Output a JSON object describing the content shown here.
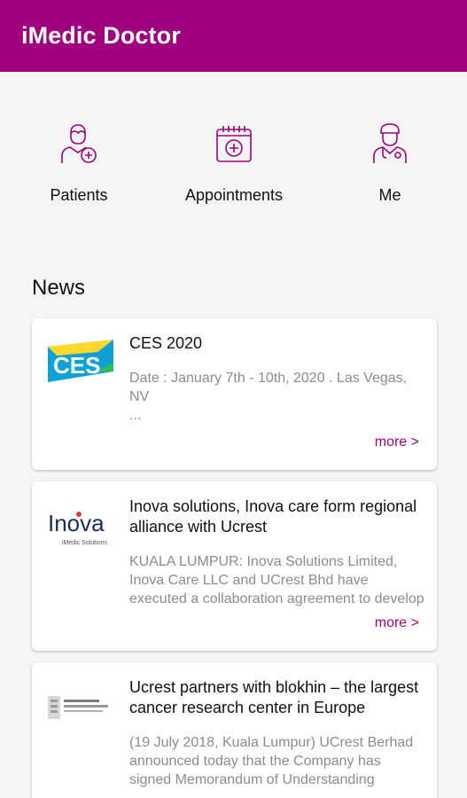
{
  "app": {
    "title": "iMedic Doctor",
    "accent": "#a0007f"
  },
  "quick_actions": [
    {
      "label": "Patients",
      "icon": "patient-add-icon"
    },
    {
      "label": "Appointments",
      "icon": "calendar-icon"
    },
    {
      "label": "Me",
      "icon": "doctor-icon"
    }
  ],
  "news": {
    "title": "News",
    "items": [
      {
        "logo": "CES",
        "logo_icon": "ces-logo",
        "headline": "CES 2020",
        "body": "Date : January 7th - 10th, 2020 . Las Vegas, NV\n...",
        "more": "more >"
      },
      {
        "logo": "Inova",
        "logo_sub": "iMedic Solutions",
        "logo_icon": "inova-logo",
        "headline": "Inova solutions, Inova care form regional alliance with Ucrest",
        "body": "KUALA LUMPUR: Inova Solutions Limited, Inova Care LLC and UCrest Bhd have executed a collaboration agreement to develop",
        "more": "more >"
      },
      {
        "logo": "blokhin",
        "logo_icon": "blokhin-logo",
        "headline": "Ucrest partners with blokhin – the largest cancer research center in Europe",
        "body": "(19 July 2018, Kuala Lumpur) UCrest Berhad announced today that the Company has signed Memorandum of Understanding"
      }
    ]
  }
}
